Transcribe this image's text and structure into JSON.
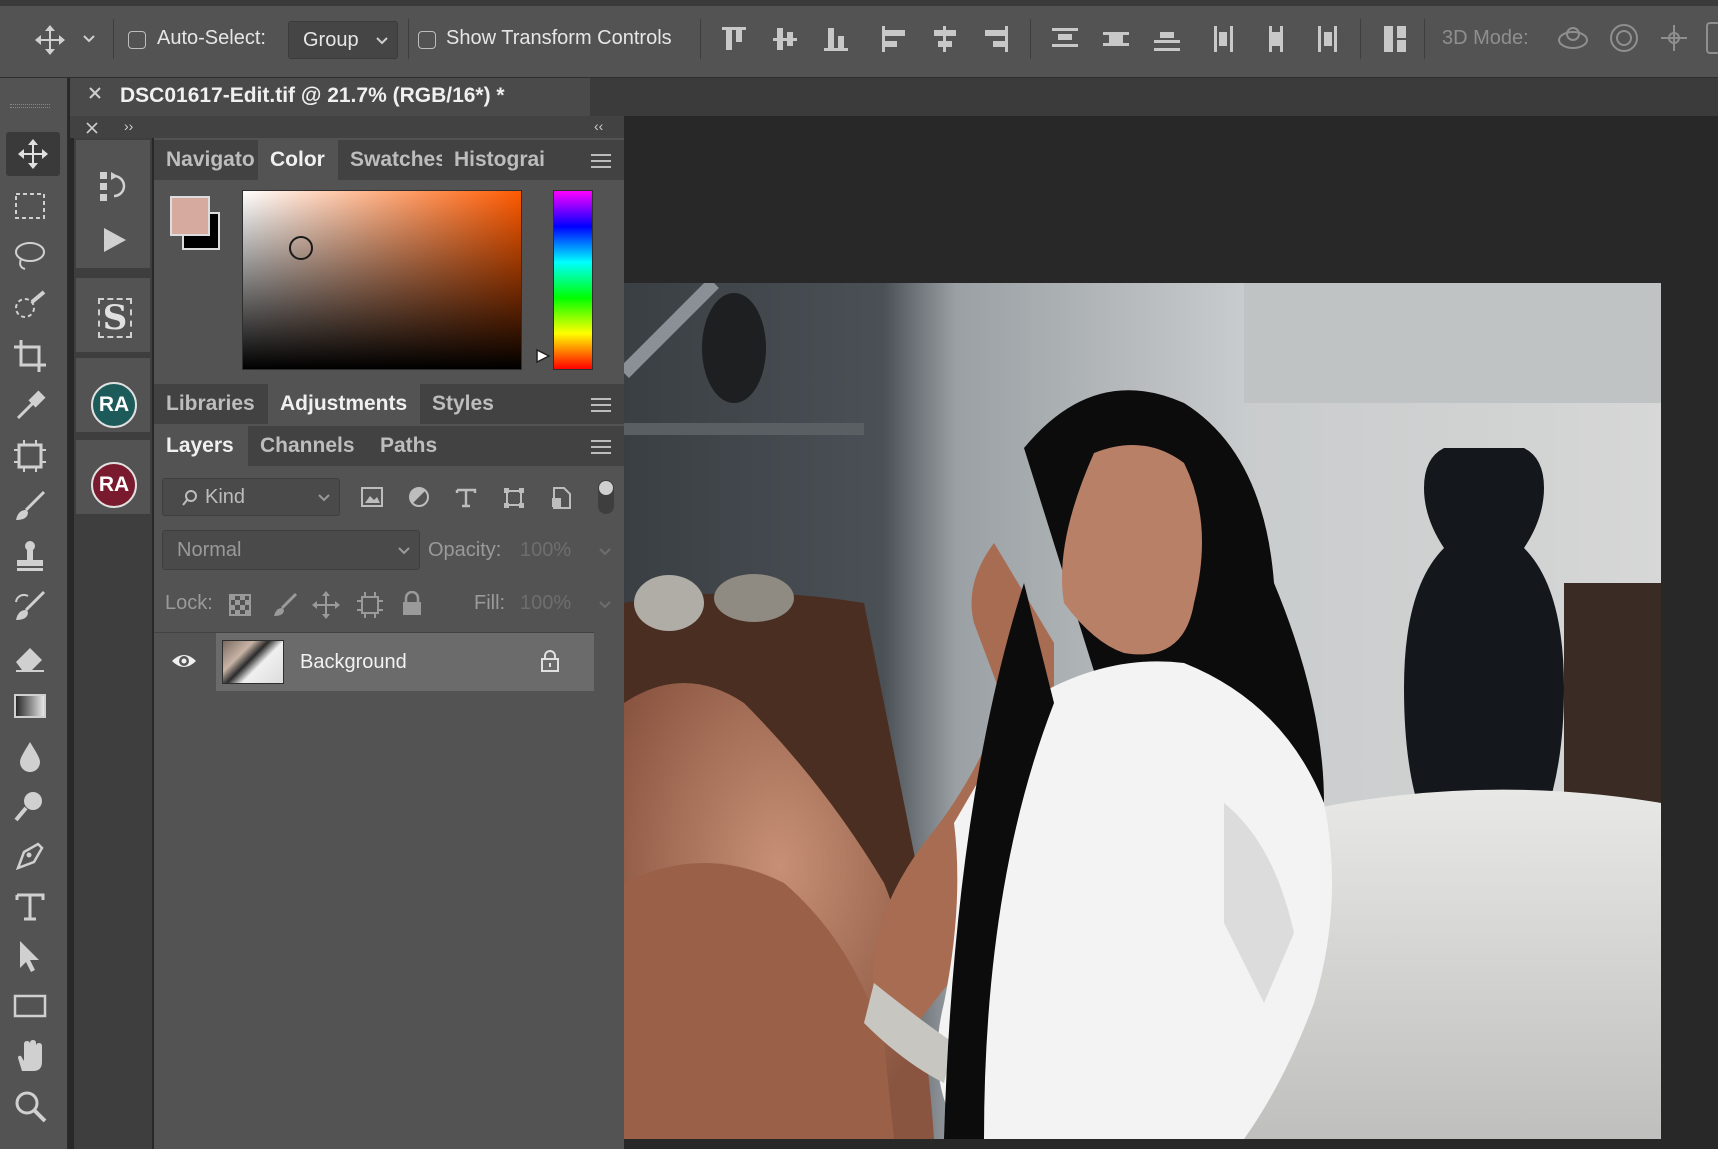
{
  "options_bar": {
    "auto_select_label": "Auto-Select:",
    "auto_select_value": "Group",
    "transform_label": "Show Transform Controls",
    "mode_3d_label": "3D Mode:"
  },
  "document": {
    "tab_title": "DSC01617-Edit.tif @ 21.7% (RGB/16*) *"
  },
  "color_panel": {
    "tabs": [
      "Navigato",
      "Color",
      "Swatches",
      "Histograi"
    ],
    "active_tab": "Color",
    "foreground": "#d7aaa0",
    "background": "#000000",
    "hue_color": "#ff5a00"
  },
  "adjustments_tabs": [
    "Libraries",
    "Adjustments",
    "Styles"
  ],
  "layers_panel": {
    "tabs": [
      "Layers",
      "Channels",
      "Paths"
    ],
    "filter_placeholder": "Kind",
    "blend_mode": "Normal",
    "opacity_label": "Opacity:",
    "opacity_value": "100%",
    "lock_label": "Lock:",
    "fill_label": "Fill:",
    "fill_value": "100%",
    "layers": [
      {
        "name": "Background",
        "visible": true,
        "locked": true
      }
    ]
  },
  "dock": {
    "badge1": "RA",
    "badge1_color": "#1d5a5a",
    "badge2": "RA",
    "badge2_color": "#7a1a2e"
  },
  "icons": [
    "move-tool-icon",
    "marquee-icon",
    "lasso-icon",
    "quick-select-icon",
    "crop-icon",
    "eyedropper-icon",
    "frame-icon",
    "brush-icon",
    "stamp-icon",
    "history-brush-icon",
    "eraser-icon",
    "gradient-icon",
    "blur-icon",
    "dodge-icon",
    "pen-icon",
    "type-icon",
    "path-select-icon",
    "rectangle-icon",
    "hand-icon",
    "zoom-icon"
  ]
}
